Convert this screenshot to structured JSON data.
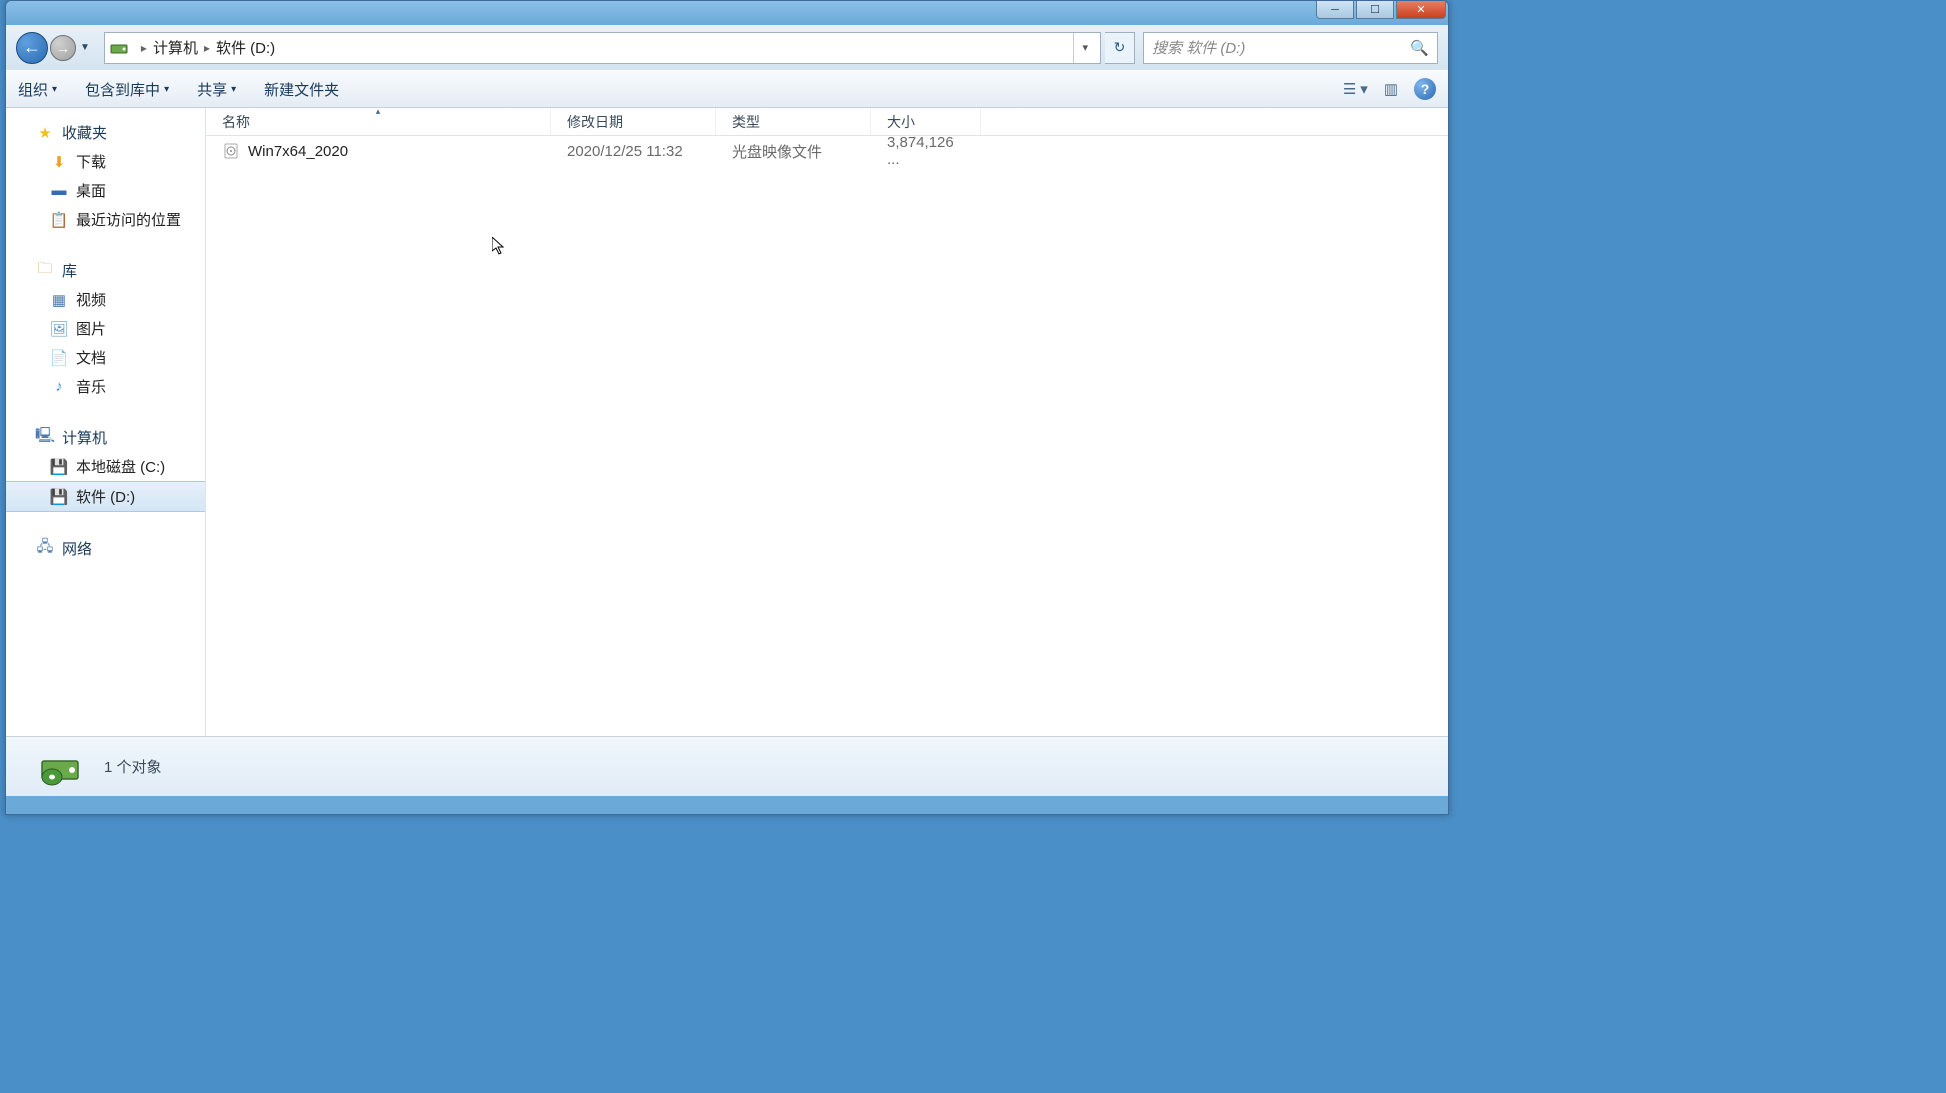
{
  "titlebar": {
    "min_symbol": "─",
    "max_symbol": "☐",
    "close_symbol": "✕"
  },
  "nav": {
    "back_symbol": "←",
    "fwd_symbol": "→",
    "dropdown_symbol": "▼"
  },
  "address": {
    "segments": [
      "计算机",
      "软件 (D:)"
    ],
    "separator": "▸",
    "dropdown_symbol": "▾",
    "refresh_symbol": "↻"
  },
  "search": {
    "placeholder": "搜索 软件 (D:)",
    "icon_symbol": "🔍"
  },
  "toolbar": {
    "organize": "组织",
    "include": "包含到库中",
    "share": "共享",
    "new_folder": "新建文件夹",
    "caret": "▾",
    "view_symbol": "☰",
    "preview_symbol": "▥",
    "help_symbol": "?"
  },
  "sidebar": {
    "favorites": {
      "label": "收藏夹",
      "items": [
        {
          "icon": "⬇",
          "label": "下载",
          "color": "#f0a020"
        },
        {
          "icon": "▬",
          "label": "桌面",
          "color": "#3a6ab0"
        },
        {
          "icon": "📋",
          "label": "最近访问的位置",
          "color": "#8a9aaa"
        }
      ]
    },
    "libraries": {
      "label": "库",
      "items": [
        {
          "icon": "▦",
          "label": "视频",
          "color": "#4a7ab0"
        },
        {
          "icon": "🖼",
          "label": "图片",
          "color": "#6a9ac0"
        },
        {
          "icon": "📄",
          "label": "文档",
          "color": "#8a9aaa"
        },
        {
          "icon": "♪",
          "label": "音乐",
          "color": "#4a90d0"
        }
      ]
    },
    "computer": {
      "label": "计算机",
      "items": [
        {
          "icon": "💾",
          "label": "本地磁盘 (C:)",
          "selected": false
        },
        {
          "icon": "💾",
          "label": "软件 (D:)",
          "selected": true
        }
      ]
    },
    "network": {
      "label": "网络"
    }
  },
  "columns": {
    "name": "名称",
    "date": "修改日期",
    "type": "类型",
    "size": "大小",
    "sort_asc": "▴"
  },
  "files": [
    {
      "name": "Win7x64_2020",
      "date": "2020/12/25 11:32",
      "type": "光盘映像文件",
      "size": "3,874,126 ..."
    }
  ],
  "status": {
    "count_text": "1 个对象"
  }
}
